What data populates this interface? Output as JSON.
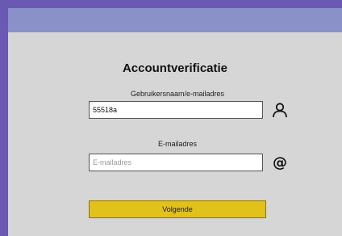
{
  "form": {
    "title": "Accountverificatie",
    "username": {
      "label": "Gebruikersnaam/e-mailadres",
      "value": "55518a"
    },
    "email": {
      "label": "E-mailadres",
      "placeholder": "E-mailadres",
      "value": ""
    },
    "next_label": "Volgende"
  },
  "icons": {
    "username": "user-icon",
    "email": "at-sign-icon"
  },
  "colors": {
    "outer_background": "#6a59b3",
    "panel_background": "#d6d6d6",
    "header_bar": "#8a91c9",
    "button": "#e2c11a"
  }
}
